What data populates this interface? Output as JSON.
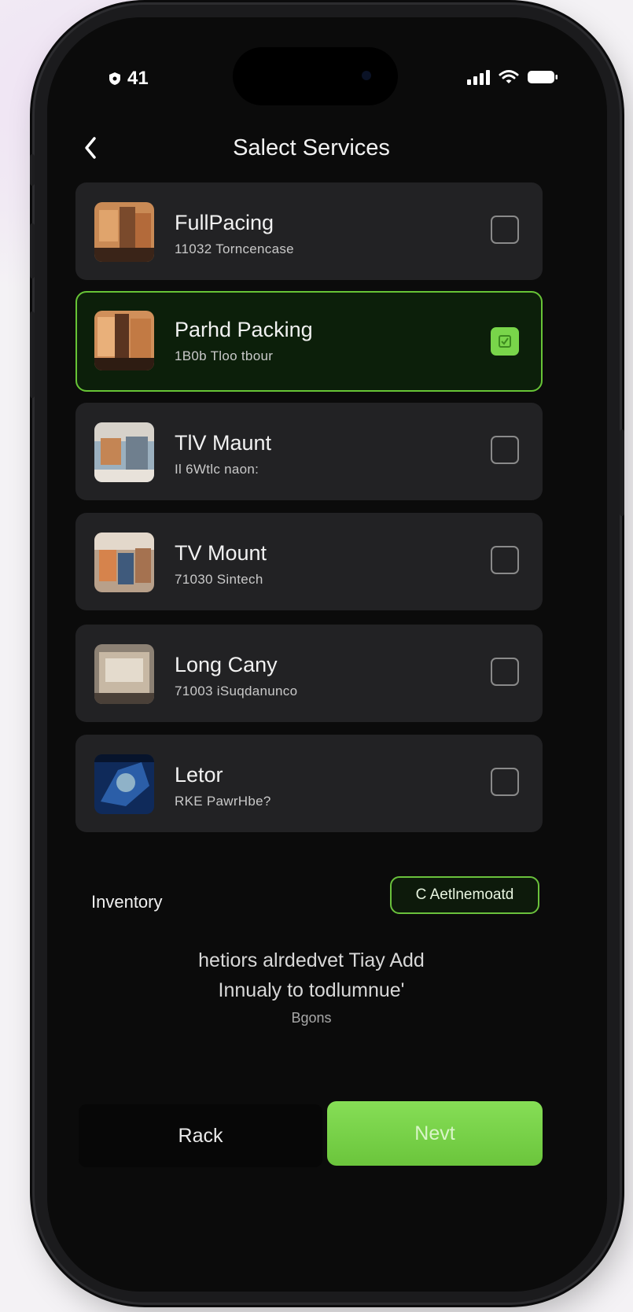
{
  "status_bar": {
    "time": "41"
  },
  "header": {
    "title": "Salect Services"
  },
  "services": [
    {
      "title": "FullPacing",
      "subtitle": "11032 Torncencase",
      "checked": false,
      "thumb": "boxes-photo"
    },
    {
      "title": "Parhd Packing",
      "subtitle": "1B0b Tloo tbour",
      "checked": true,
      "thumb": "boxes-photo"
    },
    {
      "title": "TlV Maunt",
      "subtitle": "Il 6Wtlc naon:",
      "checked": false,
      "thumb": "room-photo"
    },
    {
      "title": "TV Mount",
      "subtitle": "71030 Sintech",
      "checked": false,
      "thumb": "room-photo"
    },
    {
      "title": "Long Cany",
      "subtitle": "71003 iSuqdanunco",
      "checked": false,
      "thumb": "box-photo"
    },
    {
      "title": "Letor",
      "subtitle": "RKE PawrHbe?",
      "checked": false,
      "thumb": "blue-photo"
    }
  ],
  "inventory": {
    "label": "Inventory",
    "button_label": "C Aetlnemoatd",
    "empty_line1": "hetiors alrdedvet Tiay Add",
    "empty_line2": "Innualy  to todlumnue'",
    "empty_caption": "Bgons"
  },
  "footer": {
    "back_label": "Rack",
    "next_label": "Nevt"
  },
  "colors": {
    "accent": "#79d54a",
    "card_bg": "#222224",
    "selected_bg": "#0c1f0a"
  }
}
